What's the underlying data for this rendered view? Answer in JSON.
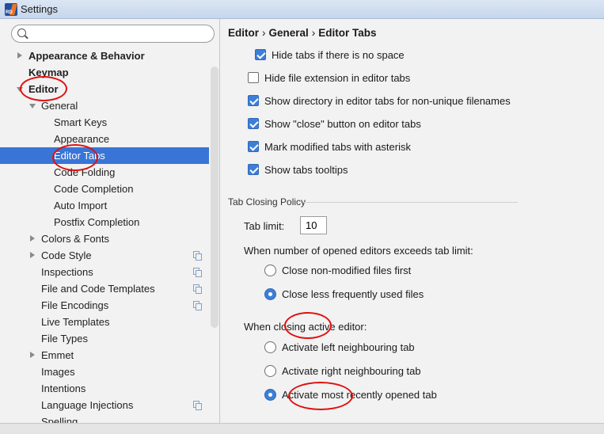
{
  "window": {
    "title": "Settings"
  },
  "search": {
    "placeholder": "",
    "value": ""
  },
  "tree": {
    "appearance_behavior": "Appearance & Behavior",
    "keymap": "Keymap",
    "editor": "Editor",
    "general": "General",
    "smart_keys": "Smart Keys",
    "appearance": "Appearance",
    "editor_tabs": "Editor Tabs",
    "code_folding": "Code Folding",
    "code_completion": "Code Completion",
    "auto_import": "Auto Import",
    "postfix_completion": "Postfix Completion",
    "colors_fonts": "Colors & Fonts",
    "code_style": "Code Style",
    "inspections": "Inspections",
    "file_code_templates": "File and Code Templates",
    "file_encodings": "File Encodings",
    "live_templates": "Live Templates",
    "file_types": "File Types",
    "emmet": "Emmet",
    "images": "Images",
    "intentions": "Intentions",
    "language_injections": "Language Injections",
    "spelling": "Spelling"
  },
  "breadcrumb": {
    "part1": "Editor",
    "part2": "General",
    "part3": "Editor Tabs",
    "sep": "›"
  },
  "options": {
    "hide_tabs": {
      "label": "Hide tabs if there is no space",
      "checked": true
    },
    "hide_ext": {
      "label": "Hide file extension in editor tabs",
      "checked": false
    },
    "show_dir": {
      "label": "Show directory in editor tabs for non-unique filenames",
      "checked": true
    },
    "show_close": {
      "label": "Show \"close\" button on editor tabs",
      "checked": true
    },
    "mark_modified": {
      "label": "Mark modified tabs with asterisk",
      "checked": true
    },
    "show_tooltips": {
      "label": "Show tabs tooltips",
      "checked": true
    }
  },
  "tab_closing": {
    "section_title": "Tab Closing Policy",
    "tab_limit_label": "Tab limit:",
    "tab_limit_value": "10",
    "exceeds_label": "When number of opened editors exceeds tab limit:",
    "close_non_modified": "Close non-modified files first",
    "close_less_frequent": "Close less frequently used files",
    "closing_active_label": "When closing active editor:",
    "activate_left": "Activate left neighbouring tab",
    "activate_right": "Activate right neighbouring tab",
    "activate_recent": "Activate most recently opened tab"
  },
  "colors": {
    "selection": "#3875d7",
    "checkbox_accent": "#3d7fd6",
    "annotation": "#e01010"
  }
}
